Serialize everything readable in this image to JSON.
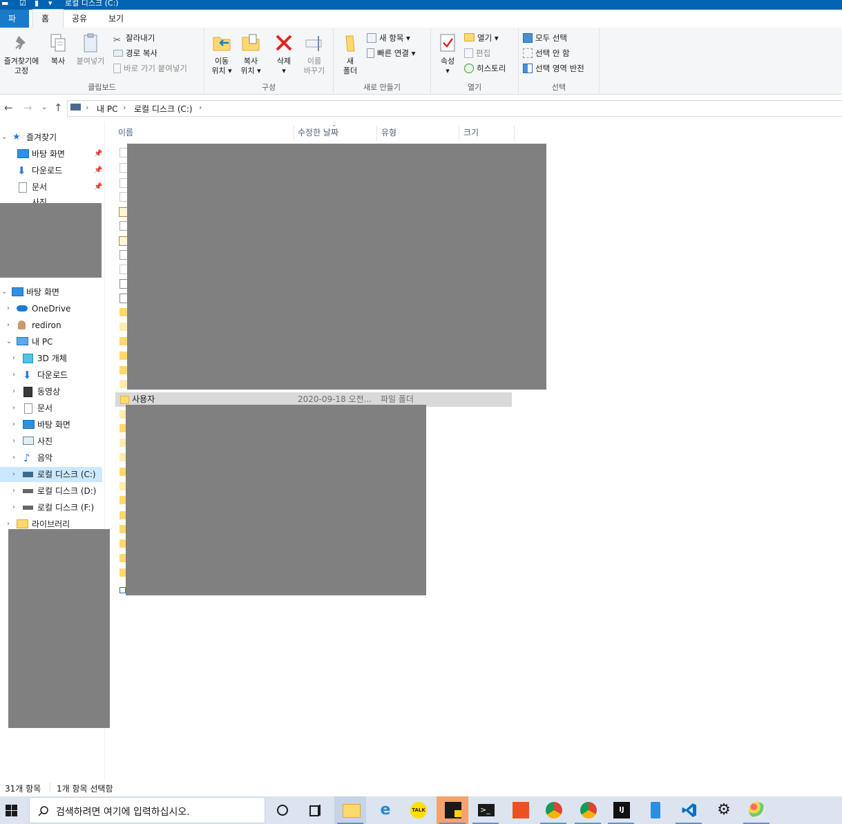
{
  "window": {
    "title": "로컬 디스크 (C:)"
  },
  "ribbon_tabs": [
    {
      "label": "파일"
    },
    {
      "label": "홈"
    },
    {
      "label": "공유"
    },
    {
      "label": "보기"
    }
  ],
  "ribbon": {
    "clipboard": {
      "label": "클립보드",
      "pin_line1": "즐겨찾기에",
      "pin_line2": "고정",
      "copy": "복사",
      "paste": "붙여넣기",
      "cut": "잘라내기",
      "copy_path": "경로 복사",
      "paste_shortcut": "바로 가기 붙여넣기"
    },
    "organize": {
      "label": "구성",
      "move_line1": "이동",
      "move_line2": "위치 ▾",
      "copyto_line1": "복사",
      "copyto_line2": "위치 ▾",
      "delete_line1": "삭제",
      "delete_line2": "▾",
      "rename_line1": "이름",
      "rename_line2": "바꾸기"
    },
    "new": {
      "label": "새로 만들기",
      "folder_line1": "새",
      "folder_line2": "폴더",
      "new_item": "새 항목 ▾",
      "easy_access": "빠른 연결 ▾"
    },
    "open": {
      "label": "열기",
      "properties_line1": "속성",
      "properties_line2": "▾",
      "open": "열기 ▾",
      "edit": "편집",
      "history": "히스토리"
    },
    "select": {
      "label": "선택",
      "select_all": "모두 선택",
      "select_none": "선택 안 함",
      "invert": "선택 영역 반전"
    }
  },
  "address": {
    "crumbs": [
      "내 PC",
      "로컬 디스크 (C:)"
    ]
  },
  "nav": {
    "quick_access": "즐겨찾기",
    "quick_items": [
      "바탕 화면",
      "다운로드",
      "문서",
      "사진"
    ],
    "tree": [
      {
        "label": "바탕 화면",
        "level": 0,
        "expanded": true
      },
      {
        "label": "OneDrive",
        "level": 1
      },
      {
        "label": "rediron",
        "level": 1
      },
      {
        "label": "내 PC",
        "level": 1,
        "expanded": true
      },
      {
        "label": "3D 개체",
        "level": 2
      },
      {
        "label": "다운로드",
        "level": 2
      },
      {
        "label": "동영상",
        "level": 2
      },
      {
        "label": "문서",
        "level": 2
      },
      {
        "label": "바탕 화면",
        "level": 2
      },
      {
        "label": "사진",
        "level": 2
      },
      {
        "label": "음악",
        "level": 2
      },
      {
        "label": "로컬 디스크 (C:)",
        "level": 2,
        "selected": true
      },
      {
        "label": "로컬 디스크 (D:)",
        "level": 2
      },
      {
        "label": "로컬 디스크 (F:)",
        "level": 2
      },
      {
        "label": "라이브러리",
        "level": 1
      }
    ]
  },
  "columns": {
    "name": "이름",
    "modified": "수정한 날짜",
    "type": "유형",
    "size": "크기"
  },
  "selected_row": {
    "name": "사용자",
    "modified": "2020-09-18 오전...",
    "type": "파일 폴더"
  },
  "status": {
    "count": "31개 항목",
    "selected": "1개 항목 선택함"
  },
  "taskbar": {
    "search_placeholder": "검색하려면 여기에 입력하십시오."
  },
  "colors": {
    "titlebar": "#0063b1",
    "file_tab": "#1979ca",
    "ribbon_bg": "#f5f6f7",
    "selection": "#cce8ff",
    "redacted": "#808080",
    "taskbar": "#dbe4ef"
  }
}
